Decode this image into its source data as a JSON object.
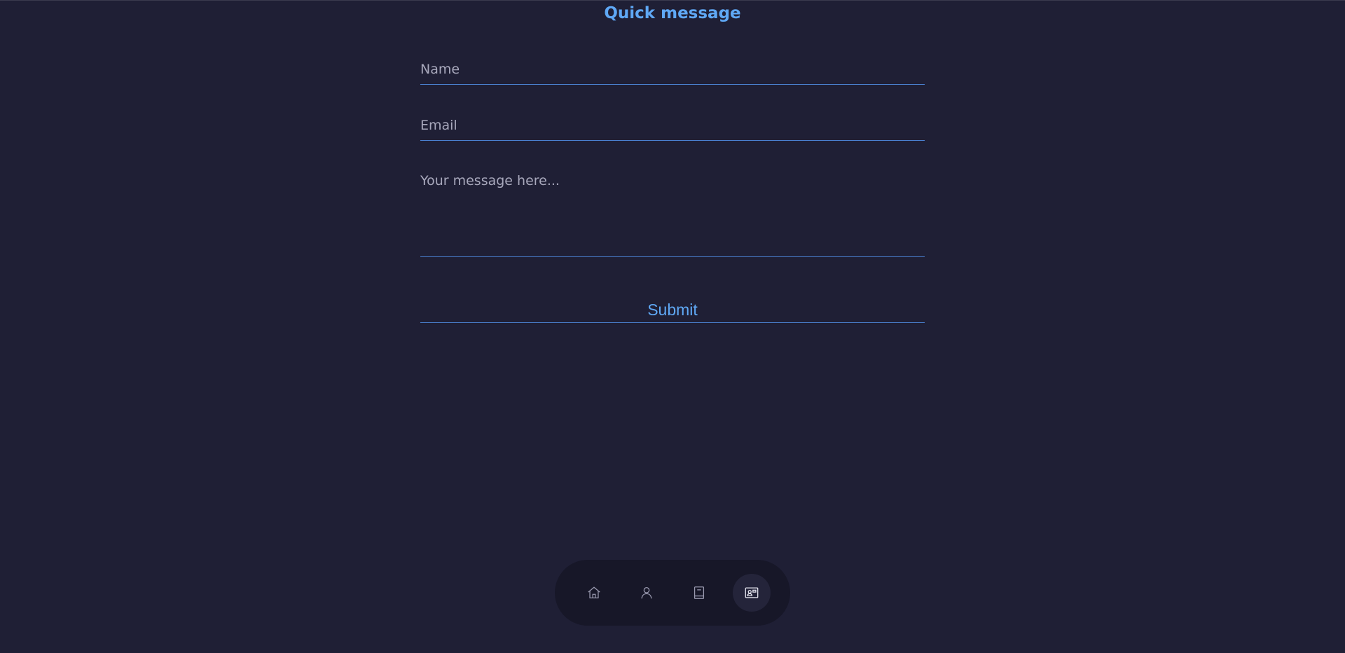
{
  "header": {
    "title": "Quick message"
  },
  "form": {
    "name_placeholder": "Name",
    "email_placeholder": "Email",
    "message_placeholder": "Your message here...",
    "submit_label": "Submit"
  },
  "nav": {
    "items": [
      {
        "icon": "home-icon",
        "active": false
      },
      {
        "icon": "user-icon",
        "active": false
      },
      {
        "icon": "book-icon",
        "active": false
      },
      {
        "icon": "contact-card-icon",
        "active": true
      }
    ]
  },
  "colors": {
    "background": "#1f1f35",
    "accent": "#5fa8f5",
    "nav_background": "#171728"
  }
}
